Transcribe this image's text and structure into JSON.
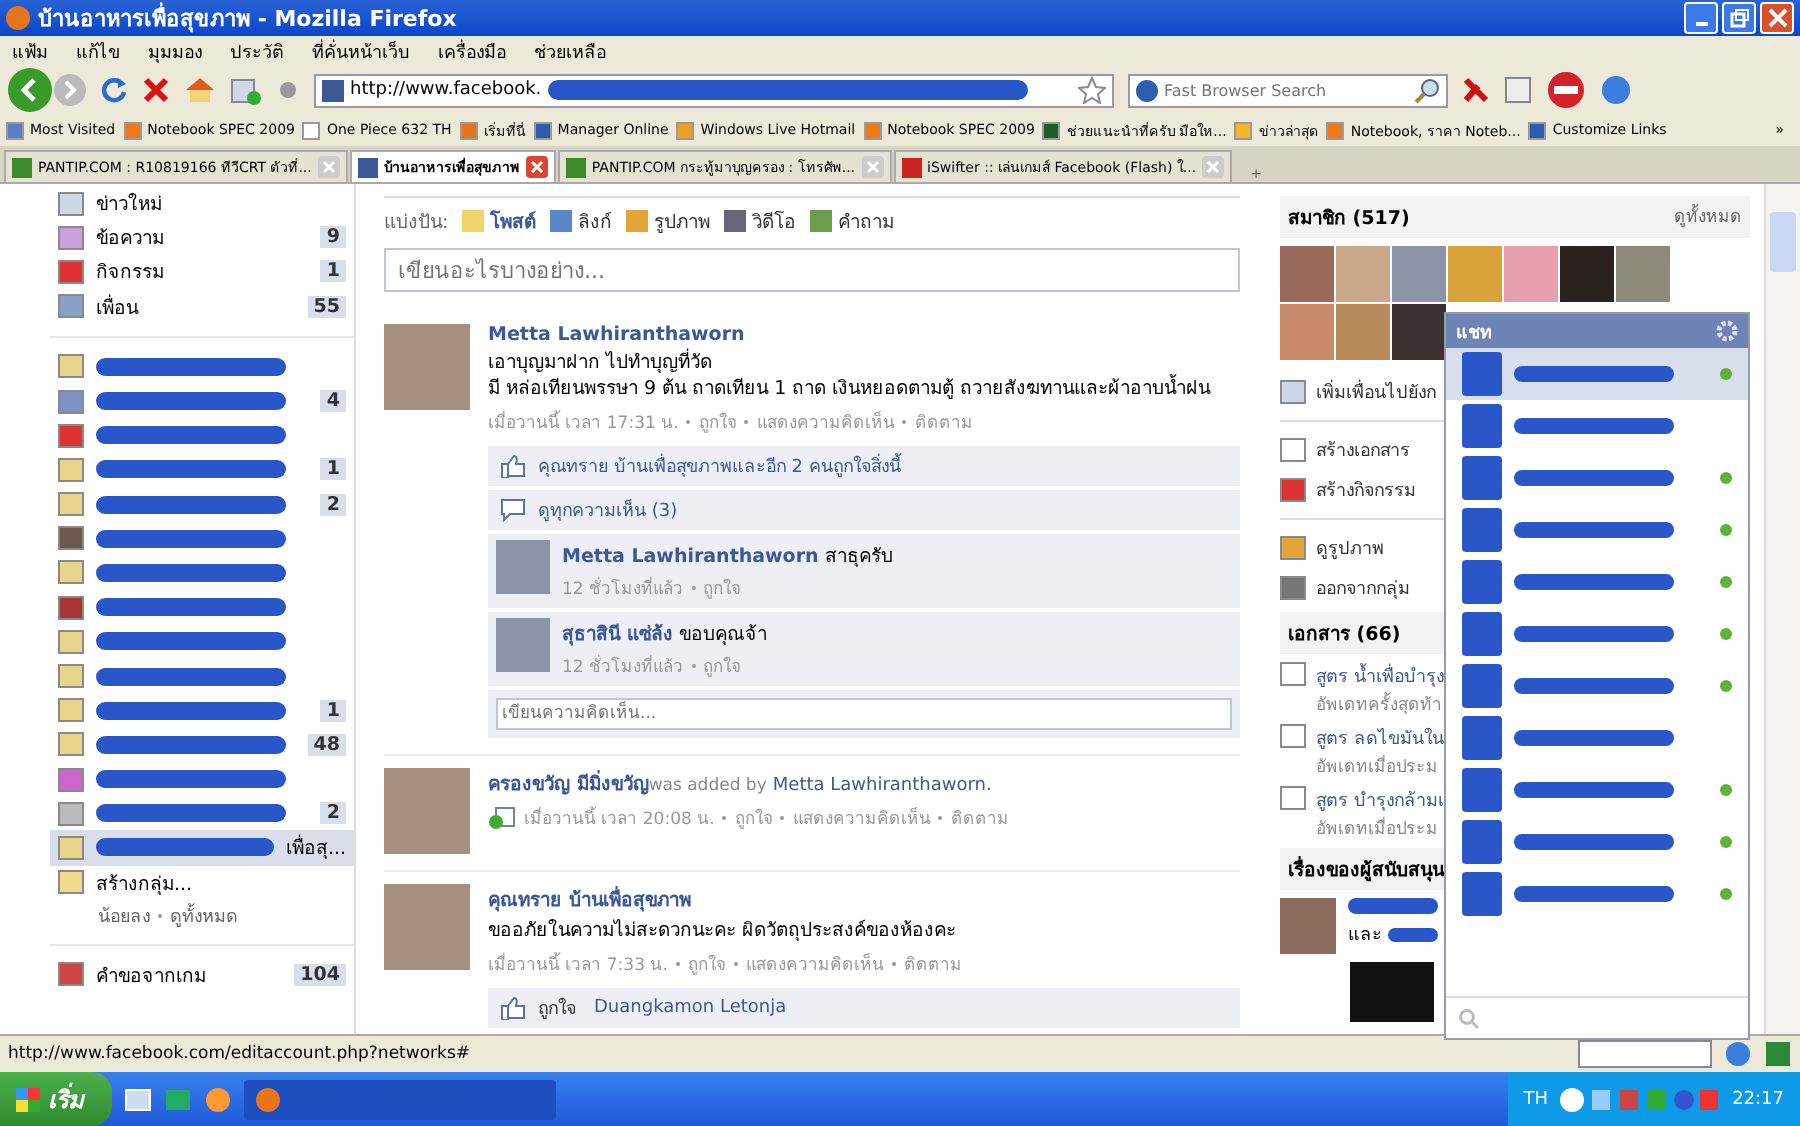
{
  "window": {
    "title": "บ้านอาหารเพื่อสุขภาพ - Mozilla Firefox"
  },
  "menu": [
    "แฟ้ม",
    "แก้ไข",
    "มุมมอง",
    "ประวัติ",
    "ที่คั่นหน้าเว็บ",
    "เครื่องมือ",
    "ช่วยเหลือ"
  ],
  "address": {
    "value": "http://www.facebook.",
    "redacted": true
  },
  "search": {
    "placeholder": "Fast Browser Search"
  },
  "bookmarks": [
    {
      "label": "Most Visited",
      "kind": "page"
    },
    {
      "label": "Notebook SPEC 2009",
      "kind": "nb"
    },
    {
      "label": "One Piece 632 TH",
      "kind": "doc"
    },
    {
      "label": "เริ่มที่นี่",
      "kind": "firefox"
    },
    {
      "label": "Manager Online",
      "kind": "letter"
    },
    {
      "label": "Windows Live Hotmail",
      "kind": "mail"
    },
    {
      "label": "Notebook SPEC 2009",
      "kind": "nb"
    },
    {
      "label": "ช่วยแนะนำที่ครับ มือให...",
      "kind": "diamond"
    },
    {
      "label": "ข่าวล่าสุด",
      "kind": "rss"
    },
    {
      "label": "Notebook, ราคา Noteb...",
      "kind": "nb"
    },
    {
      "label": "Customize Links",
      "kind": "letter"
    }
  ],
  "bookmarks_more": "»",
  "tabs": [
    {
      "label": "PANTIP.COM : R10819166 ทีวีCRT ตัวที่...",
      "kind": "cactus",
      "selected": false
    },
    {
      "label": "บ้านอาหารเพื่อสุขภาพ",
      "kind": "fb",
      "selected": true
    },
    {
      "label": "PANTIP.COM กระทู้มาบุญครอง : โทรศัพ...",
      "kind": "cactus",
      "selected": false
    },
    {
      "label": "iSwifter :: เล่นเกมส์ Facebook (Flash) ใ...",
      "kind": "tube",
      "selected": false
    }
  ],
  "new_tab": "+",
  "sidebar": {
    "items": [
      {
        "label": "ข่าวใหม่",
        "kind": "news",
        "redacted": false,
        "selected": false
      },
      {
        "label": "ข้อความ",
        "kind": "messages",
        "count": "9",
        "redacted": false,
        "selected": false
      },
      {
        "label": "กิจกรรม",
        "kind": "events",
        "count": "1",
        "redacted": false,
        "selected": false
      },
      {
        "label": "เพื่อน",
        "kind": "friends",
        "count": "55",
        "redacted": false,
        "selected": false
      }
    ],
    "groups": [
      {
        "kind": "group",
        "redacted": true,
        "selected": false
      },
      {
        "kind": "page",
        "count": "4",
        "redacted": true,
        "selected": false
      },
      {
        "kind": "events",
        "redacted": true,
        "selected": false
      },
      {
        "kind": "group",
        "count": "1",
        "redacted": true,
        "selected": false
      },
      {
        "kind": "group",
        "count": "2",
        "redacted": true,
        "selected": false
      },
      {
        "kind": "work",
        "redacted": true,
        "selected": false
      },
      {
        "kind": "group",
        "redacted": true,
        "selected": false
      },
      {
        "kind": "drink",
        "redacted": true,
        "selected": false
      },
      {
        "kind": "group",
        "redacted": true,
        "selected": false
      },
      {
        "kind": "group",
        "redacted": true,
        "selected": false
      },
      {
        "kind": "group",
        "count": "1",
        "redacted": true,
        "selected": false
      },
      {
        "kind": "group",
        "count": "48",
        "redacted": true,
        "selected": false
      },
      {
        "kind": "lab",
        "redacted": true,
        "selected": false
      },
      {
        "kind": "fist",
        "count": "2",
        "redacted": true,
        "selected": false
      },
      {
        "label": "เพื่อสุ...",
        "kind": "group",
        "redacted": true,
        "selected": true
      },
      {
        "label": "สร้างกลุ่ม...",
        "kind": "create",
        "redacted": false,
        "selected": false
      }
    ],
    "links": [
      "น้อยลง",
      "ดูทั้งหมด"
    ],
    "bottom": [
      {
        "label": "คำขอจากเกม",
        "kind": "game",
        "count": "104",
        "redacted": false,
        "selected": false
      }
    ]
  },
  "share": {
    "label": "แบ่งปัน:",
    "options": [
      {
        "label": "โพสต์",
        "kind": "post",
        "selected": true
      },
      {
        "label": "ลิงก์",
        "kind": "link",
        "selected": false
      },
      {
        "label": "รูปภาพ",
        "kind": "photo",
        "selected": false
      },
      {
        "label": "วิดีโอ",
        "kind": "video",
        "selected": false
      },
      {
        "label": "คำถาม",
        "kind": "question",
        "selected": false
      }
    ],
    "placeholder": "เขียนอะไรบางอย่าง..."
  },
  "posts": [
    {
      "author": "Metta Lawhiranthaworn",
      "lines": [
        "เอาบุญมาฝาก ไปทำบุญที่วัด",
        "มี หล่อเทียนพรรษา 9 ต้น ถาดเทียน 1 ถาด เงินหยอดตามตู้ ถวายสังฆทานและผ้าอาบน้ำฝน"
      ],
      "time": "เมื่อวานนี้ เวลา 17:31 น.",
      "actions": [
        "ถูกใจ",
        "แสดงความคิดเห็น",
        "ติดตาม"
      ],
      "likes": "คุณทราย บ้านเพื่อสุขภาพและอีก 2 คนถูกใจสิ่งนี้",
      "view_all": "ดูทุกความเห็น (3)",
      "comments": [
        {
          "author": "Metta Lawhiranthaworn",
          "text": "สาธุครับ",
          "time": "12 ชั่วโมงที่แล้ว",
          "action": "ถูกใจ"
        },
        {
          "author": "สุธาสินี แซ่ล้ง",
          "text": "ขอบคุณจ้า",
          "time": "12 ชั่วโมงที่แล้ว",
          "action": "ถูกใจ"
        }
      ],
      "comment_placeholder": "เขียนความคิดเห็น..."
    },
    {
      "author": "ครองขวัญ มีมิ่งขวัญ",
      "added_by": "was added by",
      "adder": "Metta Lawhiranthaworn.",
      "time": "เมื่อวานนี้ เวลา 20:08 น.",
      "actions": [
        "ถูกใจ",
        "แสดงความคิดเห็น",
        "ติดตาม"
      ]
    },
    {
      "author": "คุณทราย บ้านเพื่อสุขภาพ",
      "lines": [
        "ขออภัยในความไม่สะดวกนะคะ ผิดวัตถุประสงค์ของห้องคะ"
      ],
      "time": "เมื่อวานนี้ เวลา 7:33 น.",
      "actions": [
        "ถูกใจ",
        "แสดงความคิดเห็น",
        "ติดตาม"
      ],
      "likes_label": "ถูกใจ",
      "likes_name": "Duangkamon Letonja"
    }
  ],
  "members": {
    "title": "สมาชิก (517)",
    "see_all": "ดูทั้งหมด",
    "add": "เพิ่มเพื่อนไปยังก"
  },
  "actions": [
    {
      "label": "สร้างเอกสาร",
      "kind": "doc"
    },
    {
      "label": "สร้างกิจกรรม",
      "kind": "events"
    },
    {
      "label": "ดูรูปภาพ",
      "kind": "photo"
    },
    {
      "label": "ออกจากกลุ่ม",
      "kind": "door"
    }
  ],
  "docs": {
    "title": "เอกสาร (66)",
    "items": [
      {
        "title": "สูตร น้ำเพื่อบำรุง",
        "sub": "อัพเดทครั้งสุดท้า"
      },
      {
        "title": "สูตร ลดไขมันใน",
        "sub": "อัพเดทเมื่อประม"
      },
      {
        "title": "สูตร บำรุงกล้ามเ",
        "sub": "อัพเดทเมื่อประม"
      }
    ]
  },
  "sponsored": {
    "title": "เรื่องของผู้สนับสนุน",
    "and": "และ"
  },
  "chat": {
    "title": "แชท",
    "contacts": [
      {
        "online": true,
        "selected": true
      },
      {
        "online": false,
        "selected": false
      },
      {
        "online": true,
        "selected": false
      },
      {
        "online": true,
        "selected": false
      },
      {
        "online": true,
        "selected": false
      },
      {
        "online": true,
        "selected": false
      },
      {
        "online": true,
        "selected": false
      },
      {
        "online": false,
        "selected": false
      },
      {
        "online": true,
        "selected": false
      },
      {
        "online": true,
        "selected": false
      },
      {
        "online": true,
        "selected": false
      }
    ]
  },
  "status_bar": {
    "text": "http://www.facebook.com/editaccount.php?networks#"
  },
  "taskbar": {
    "start": "เริ่ม",
    "language": "TH",
    "clock": "22:17"
  }
}
